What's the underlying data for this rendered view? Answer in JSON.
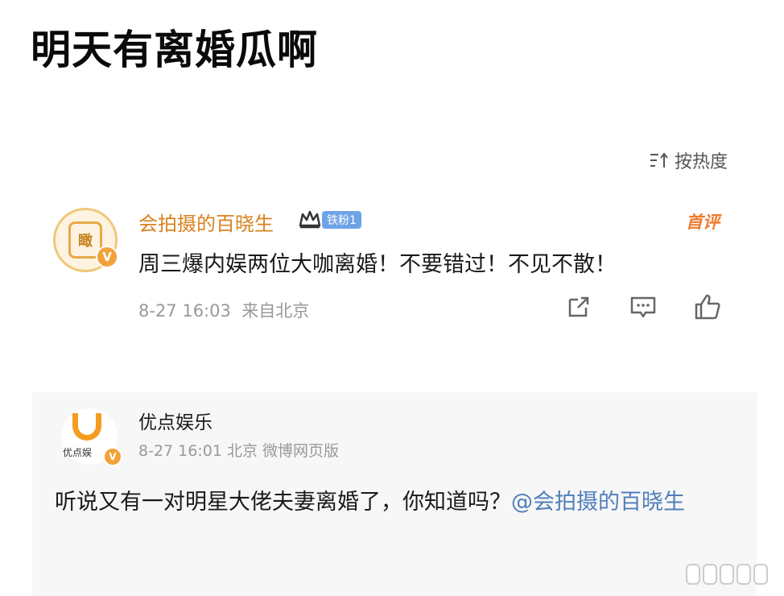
{
  "headline": "明天有离婚瓜啊",
  "sort": {
    "label": "按热度"
  },
  "comment": {
    "username": "会拍摄的百晓生",
    "avatar_text": "瞰",
    "fan_badge": "铁粉1",
    "first_comment_label": "首评",
    "text": "周三爆内娱两位大咖离婚！不要错过！不见不散！",
    "time": "8-27 16:03",
    "location": "来自北京"
  },
  "original_post": {
    "username": "优点娱乐",
    "avatar_brand": "优点娱",
    "time": "8-27 16:01",
    "location": "北京",
    "source": "微博网页版",
    "text": "听说又有一对明星大佬夫妻离婚了，你知道吗？",
    "mention": "@会拍摄的百晓生"
  },
  "colors": {
    "username_gold": "#d9821f",
    "mention_blue": "#4f7fbb",
    "meta_gray": "#999999",
    "fan_badge_blue": "#6ea3e8"
  }
}
